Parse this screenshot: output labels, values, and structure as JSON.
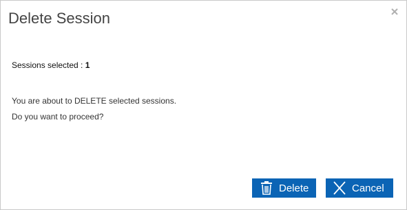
{
  "dialog": {
    "title": "Delete Session",
    "close_icon": "close-icon",
    "sessions_label": "Sessions selected :",
    "sessions_count": "1",
    "message_line1": "You are about to DELETE selected sessions.",
    "message_line2": "Do you want to proceed?",
    "delete_label": "Delete",
    "delete_icon": "trash-icon",
    "cancel_label": "Cancel",
    "cancel_icon": "x-icon"
  },
  "colors": {
    "button_bg": "#0b64b5",
    "button_text": "#ffffff",
    "border": "#c8c8c8",
    "title": "#444444"
  }
}
